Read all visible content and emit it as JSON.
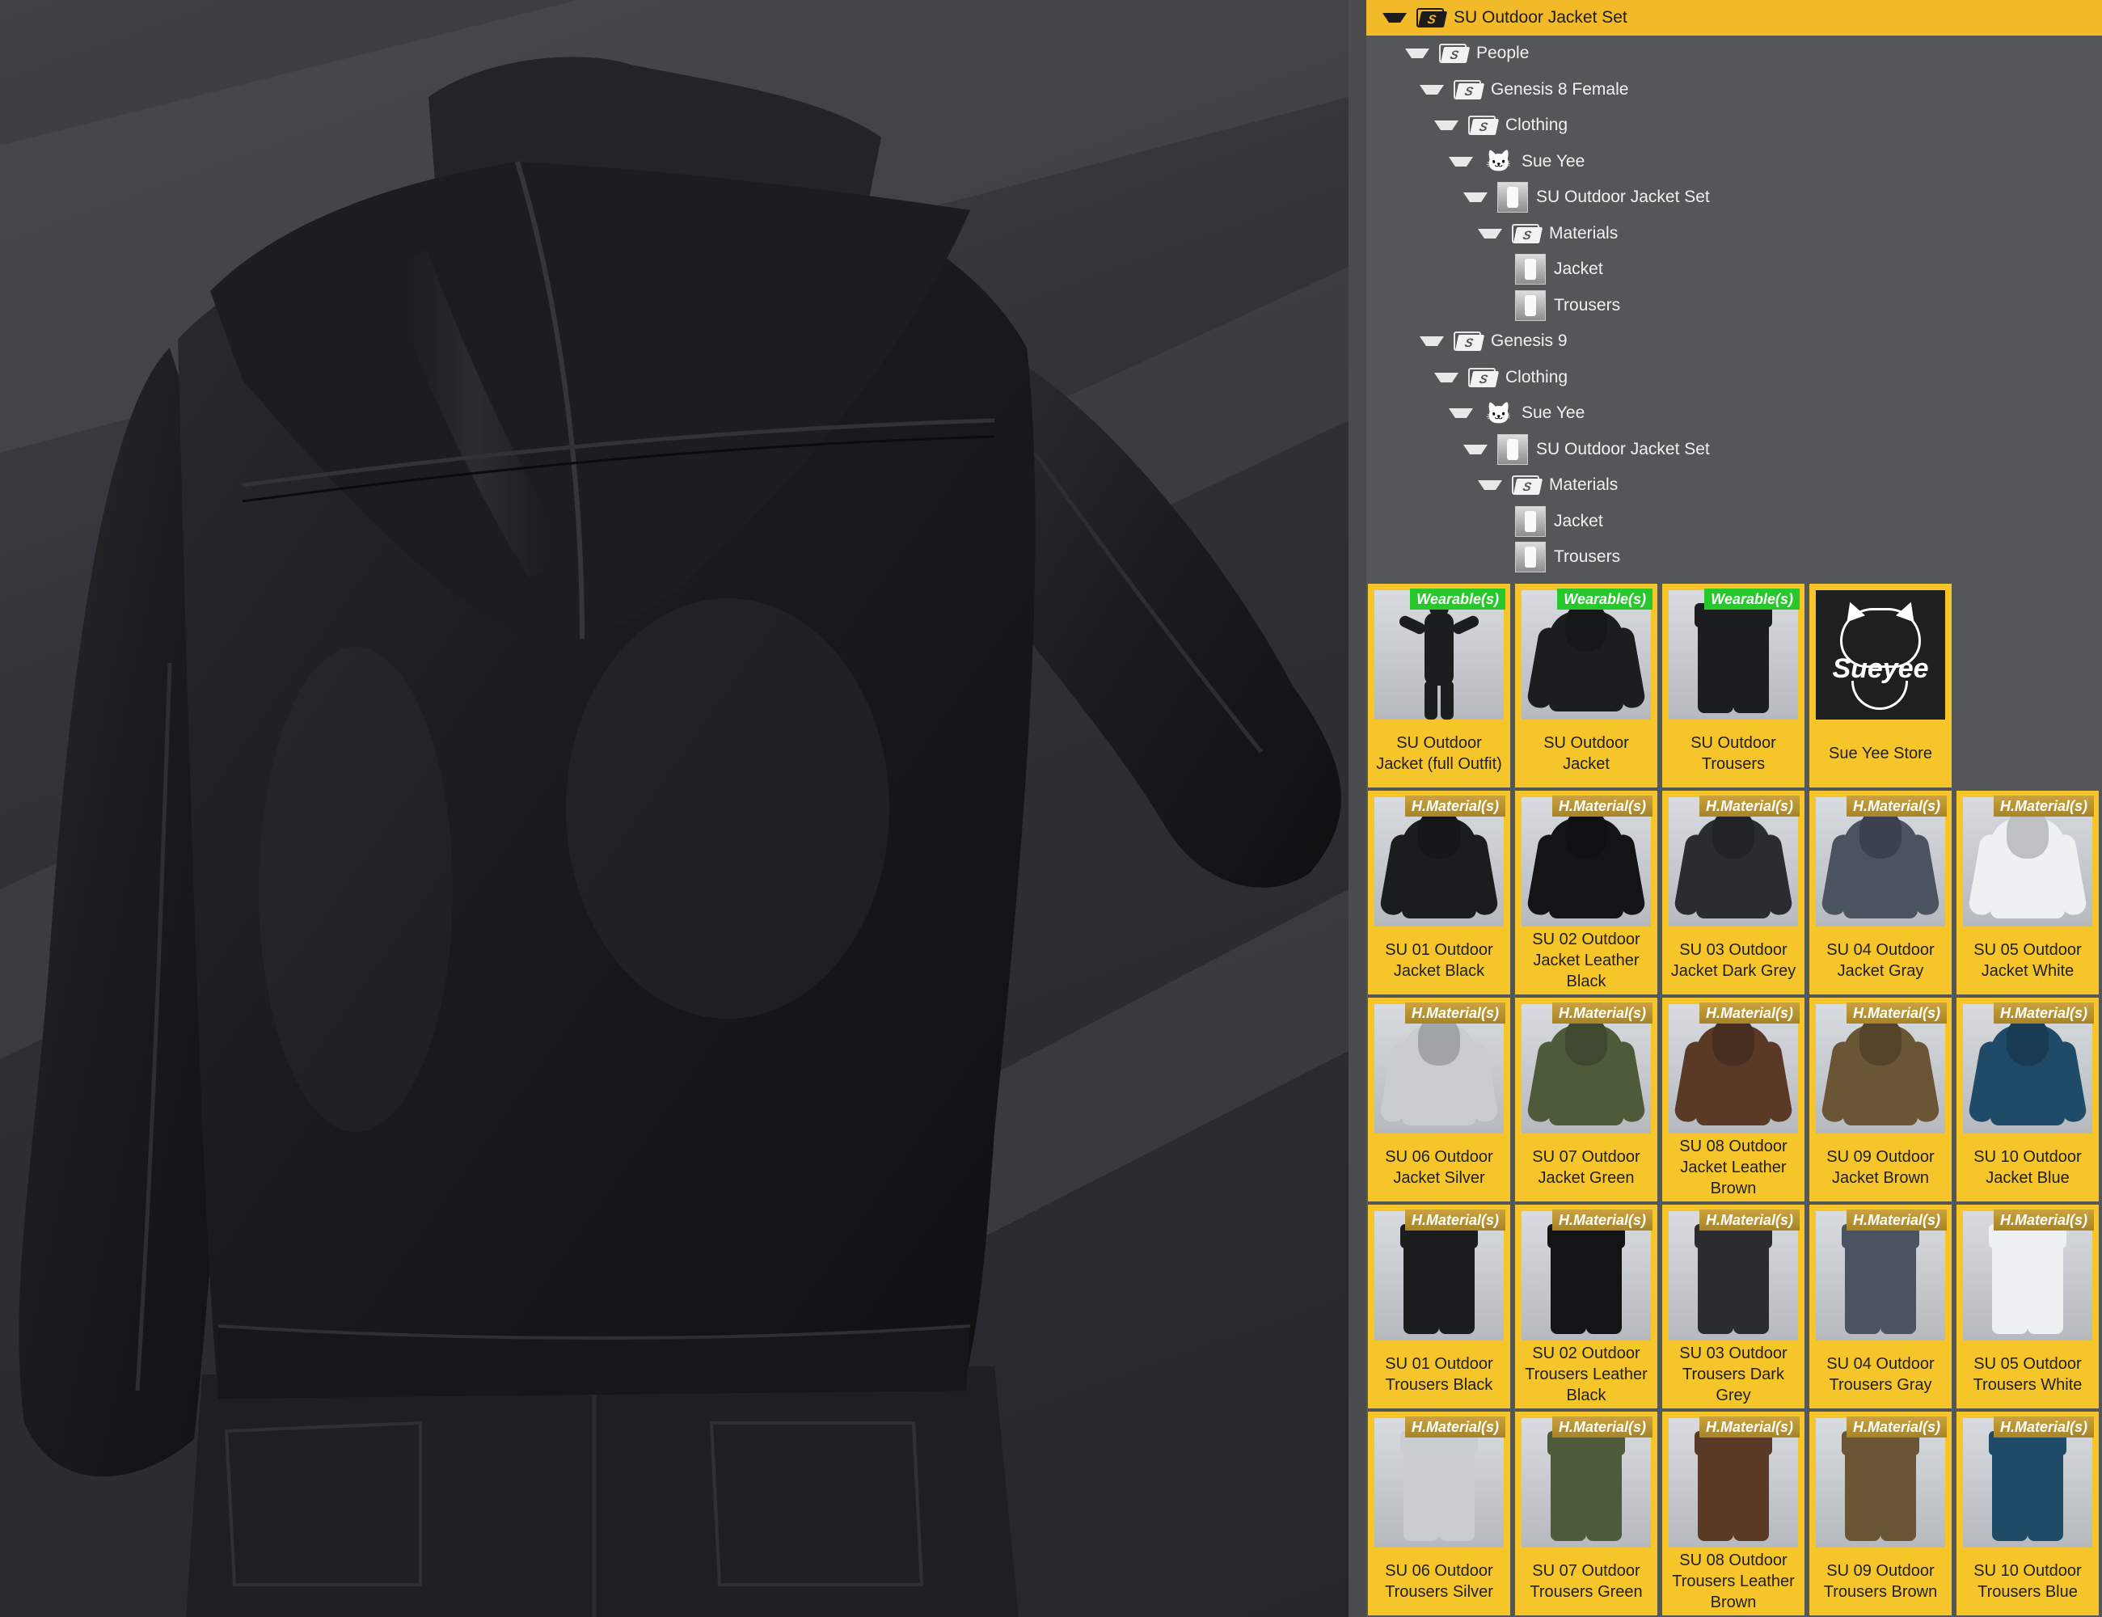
{
  "tree": [
    {
      "label": "SU Outdoor Jacket Set",
      "icon": "folder-icon",
      "level": 0,
      "selected": true
    },
    {
      "label": "People",
      "icon": "folder-icon",
      "level": 1
    },
    {
      "label": "Genesis 8 Female",
      "icon": "folder-icon",
      "level": 2
    },
    {
      "label": "Clothing",
      "icon": "folder-icon",
      "level": 3
    },
    {
      "label": "Sue Yee",
      "icon": "cat-logo-icon",
      "level": 4
    },
    {
      "label": "SU Outdoor Jacket Set",
      "icon": "jacket-thumb-icon",
      "level": 5
    },
    {
      "label": "Materials",
      "icon": "folder-icon",
      "level": 6
    },
    {
      "label": "Jacket",
      "icon": "jacket-thumb-icon",
      "level": 7,
      "leaf": true
    },
    {
      "label": "Trousers",
      "icon": "trousers-thumb-icon",
      "level": 7,
      "leaf": true
    },
    {
      "label": "Genesis 9",
      "icon": "folder-icon",
      "level": 2
    },
    {
      "label": "Clothing",
      "icon": "folder-icon",
      "level": 3
    },
    {
      "label": "Sue Yee",
      "icon": "cat-logo-icon",
      "level": 4
    },
    {
      "label": "SU Outdoor Jacket Set",
      "icon": "jacket-thumb-icon",
      "level": 5
    },
    {
      "label": "Materials",
      "icon": "folder-icon",
      "level": 6
    },
    {
      "label": "Jacket",
      "icon": "jacket-thumb-icon",
      "level": 7,
      "leaf": true
    },
    {
      "label": "Trousers",
      "icon": "trousers-thumb-icon",
      "level": 7,
      "leaf": true
    }
  ],
  "folder_glyph": "S",
  "logo_text": "Sueyee",
  "wearables": [
    {
      "label": "SU Outdoor Jacket (full Outfit)",
      "badge": "Wearable(s)",
      "kind": "figure",
      "color": "#1c1d1f"
    },
    {
      "label": "SU Outdoor Jacket",
      "badge": "Wearable(s)",
      "kind": "jacket",
      "color": "#1c1d1f"
    },
    {
      "label": "SU Outdoor Trousers",
      "badge": "Wearable(s)",
      "kind": "pants",
      "color": "#1c1d1f"
    },
    {
      "label": "Sue Yee Store",
      "badge": "",
      "kind": "logo",
      "color": "#1f1f1f"
    }
  ],
  "materials": [
    {
      "label": "SU 01 Outdoor Jacket Black",
      "badge": "H.Material(s)",
      "kind": "jacket",
      "color": "#1b1c1e"
    },
    {
      "label": "SU 02 Outdoor Jacket Leather Black",
      "badge": "H.Material(s)",
      "kind": "jacket",
      "color": "#141416"
    },
    {
      "label": "SU 03 Outdoor Jacket Dark Grey",
      "badge": "H.Material(s)",
      "kind": "jacket",
      "color": "#2a2c30"
    },
    {
      "label": "SU 04 Outdoor Jacket Gray",
      "badge": "H.Material(s)",
      "kind": "jacket",
      "color": "#4b5360"
    },
    {
      "label": "SU 05 Outdoor Jacket White",
      "badge": "H.Material(s)",
      "kind": "jacket",
      "color": "#eef0f2"
    },
    {
      "label": "SU 06 Outdoor Jacket Silver",
      "badge": "H.Material(s)",
      "kind": "jacket",
      "color": "#c9cdd2"
    },
    {
      "label": "SU 07 Outdoor Jacket Green",
      "badge": "H.Material(s)",
      "kind": "jacket",
      "color": "#4d5b3b"
    },
    {
      "label": "SU 08 Outdoor Jacket Leather Brown",
      "badge": "H.Material(s)",
      "kind": "jacket",
      "color": "#5a3a26"
    },
    {
      "label": "SU 09 Outdoor Jacket Brown",
      "badge": "H.Material(s)",
      "kind": "jacket",
      "color": "#6a5534"
    },
    {
      "label": "SU 10 Outdoor Jacket Blue",
      "badge": "H.Material(s)",
      "kind": "jacket",
      "color": "#1f4a68"
    },
    {
      "label": "SU 01 Outdoor Trousers Black",
      "badge": "H.Material(s)",
      "kind": "pants",
      "color": "#1b1c1e"
    },
    {
      "label": "SU 02 Outdoor Trousers Leather Black",
      "badge": "H.Material(s)",
      "kind": "pants",
      "color": "#141416"
    },
    {
      "label": "SU 03 Outdoor Trousers Dark Grey",
      "badge": "H.Material(s)",
      "kind": "pants",
      "color": "#2a2c30"
    },
    {
      "label": "SU 04 Outdoor Trousers Gray",
      "badge": "H.Material(s)",
      "kind": "pants",
      "color": "#4b5360"
    },
    {
      "label": "SU 05 Outdoor Trousers White",
      "badge": "H.Material(s)",
      "kind": "pants",
      "color": "#eef0f2"
    },
    {
      "label": "SU 06 Outdoor Trousers Silver",
      "badge": "H.Material(s)",
      "kind": "pants",
      "color": "#c9cdd2"
    },
    {
      "label": "SU 07 Outdoor Trousers Green",
      "badge": "H.Material(s)",
      "kind": "pants",
      "color": "#4d5b3b"
    },
    {
      "label": "SU 08 Outdoor Trousers Leather Brown",
      "badge": "H.Material(s)",
      "kind": "pants",
      "color": "#5a3a26"
    },
    {
      "label": "SU 09 Outdoor Trousers Brown",
      "badge": "H.Material(s)",
      "kind": "pants",
      "color": "#6a5534"
    },
    {
      "label": "SU 10 Outdoor Trousers Blue",
      "badge": "H.Material(s)",
      "kind": "pants",
      "color": "#1f4a68"
    }
  ]
}
